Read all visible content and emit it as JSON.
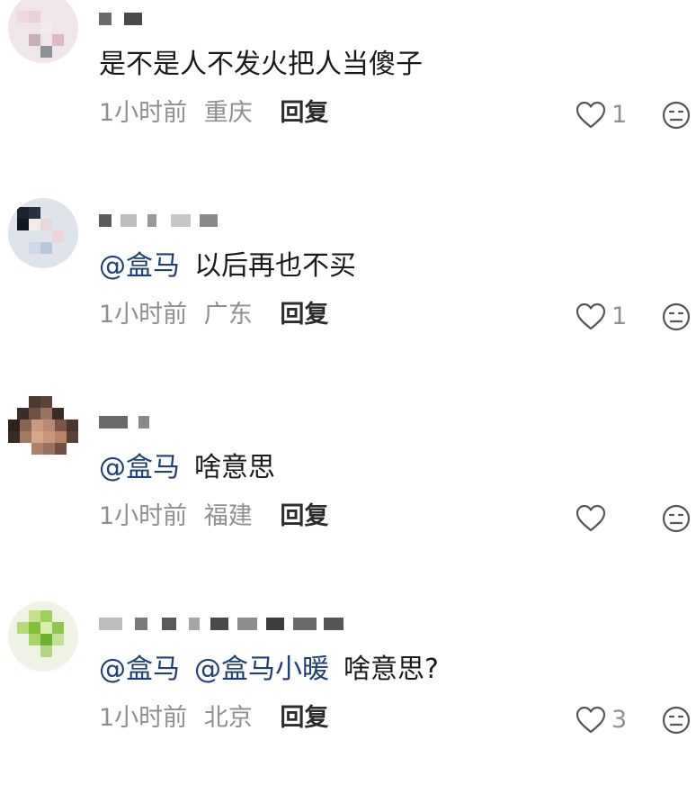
{
  "comments": [
    {
      "content_segments": [
        "是不是人不发火把人当傻子"
      ],
      "time": "1小时前",
      "location": "重庆",
      "reply_label": "回复",
      "like_count": "1"
    },
    {
      "mentions": [
        "@盒马"
      ],
      "text": "以后再也不买",
      "time": "1小时前",
      "location": "广东",
      "reply_label": "回复",
      "like_count": "1"
    },
    {
      "mentions": [
        "@盒马"
      ],
      "text": "啥意思",
      "time": "1小时前",
      "location": "福建",
      "reply_label": "回复",
      "like_count": ""
    },
    {
      "mentions": [
        "@盒马",
        "@盒马小暖"
      ],
      "text": "啥意思?",
      "time": "1小时前",
      "location": "北京",
      "reply_label": "回复",
      "like_count": "3"
    }
  ],
  "colors": {
    "mention": "#1f3f7a",
    "meta_gray": "#8f8f8f",
    "text": "#1a1a1a"
  },
  "icons": [
    "heart-icon",
    "neutral-face-icon"
  ]
}
